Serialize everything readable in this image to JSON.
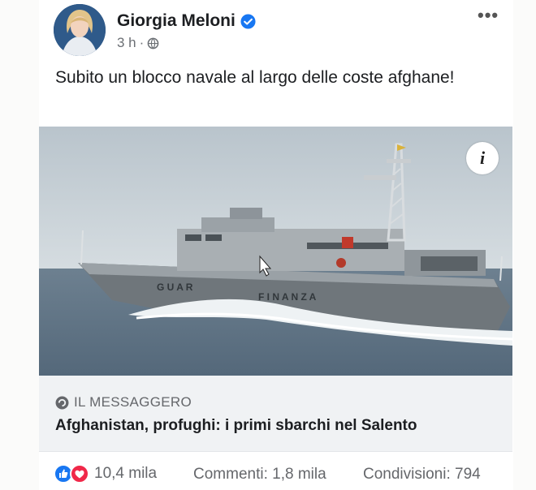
{
  "post": {
    "author_name": "Giorgia Meloni",
    "time": "3 h",
    "separator": "·",
    "text": "Subito un blocco navale al largo delle coste afghane!"
  },
  "link_preview": {
    "source": "IL MESSAGGERO",
    "headline": "Afghanistan, profughi: i primi sbarchi nel Salento",
    "image_hull_text_left": "G U A R",
    "image_hull_text_right": "F I N A N Z A"
  },
  "engagement": {
    "reactions_count": "10,4 mila",
    "comments": "Commenti: 1,8 mila",
    "shares": "Condivisioni: 794"
  },
  "icons": {
    "verified": "verified-badge-icon",
    "privacy": "globe-icon",
    "more": "more-options-icon",
    "info": "info-icon",
    "source": "link-source-icon",
    "like": "like-icon",
    "love": "love-icon"
  },
  "colors": {
    "verified": "#1877f2",
    "like": "#1877f2",
    "love": "#f02849",
    "text_secondary": "#65676b"
  }
}
